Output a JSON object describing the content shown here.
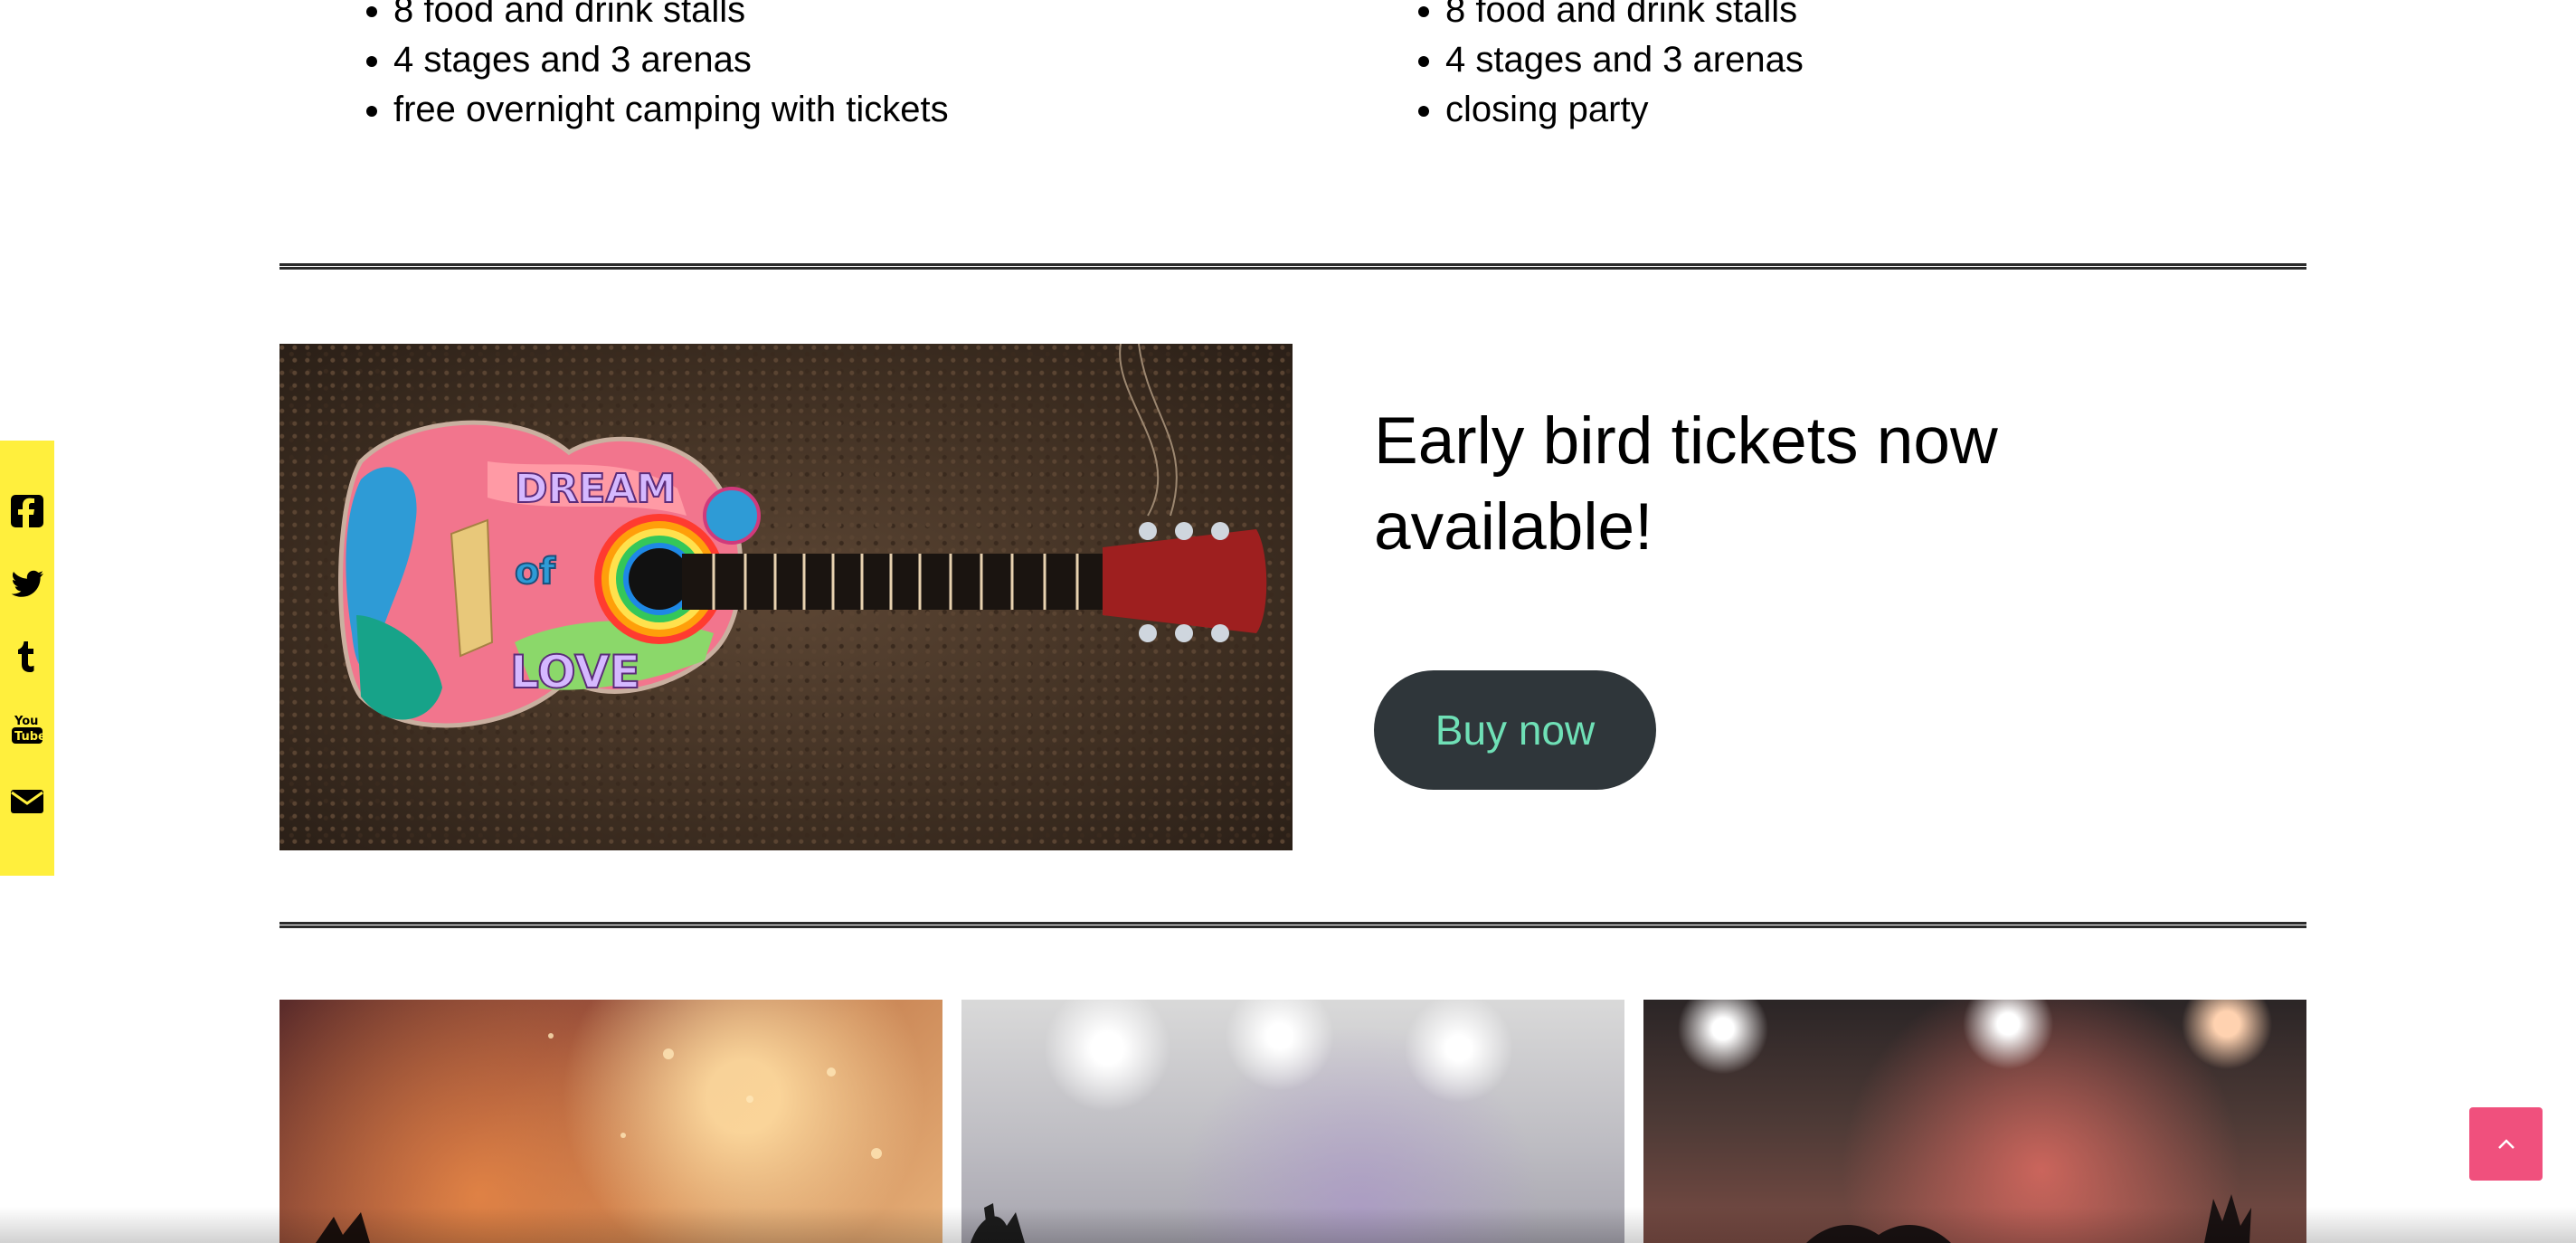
{
  "features": {
    "left": [
      "8 food and drink stalls",
      "4 stages and 3 arenas",
      "free overnight camping with tickets"
    ],
    "right": [
      "8 food and drink stalls",
      "4 stages and 3 arenas",
      "closing party"
    ]
  },
  "promo": {
    "heading": "Early bird tickets now available!",
    "button_label": "Buy now",
    "guitar_text": [
      "DREAM",
      "of",
      "LOVE"
    ]
  },
  "social": {
    "icons": [
      "facebook-icon",
      "twitter-icon",
      "tumblr-icon",
      "youtube-icon",
      "email-icon"
    ]
  },
  "back_to_top": {
    "icon": "chevron-up-icon"
  },
  "colors": {
    "social_bar": "#ffef3d",
    "button_bg": "#2f363a",
    "button_text": "#6fe0b6",
    "back_to_top": "#f0507d"
  }
}
